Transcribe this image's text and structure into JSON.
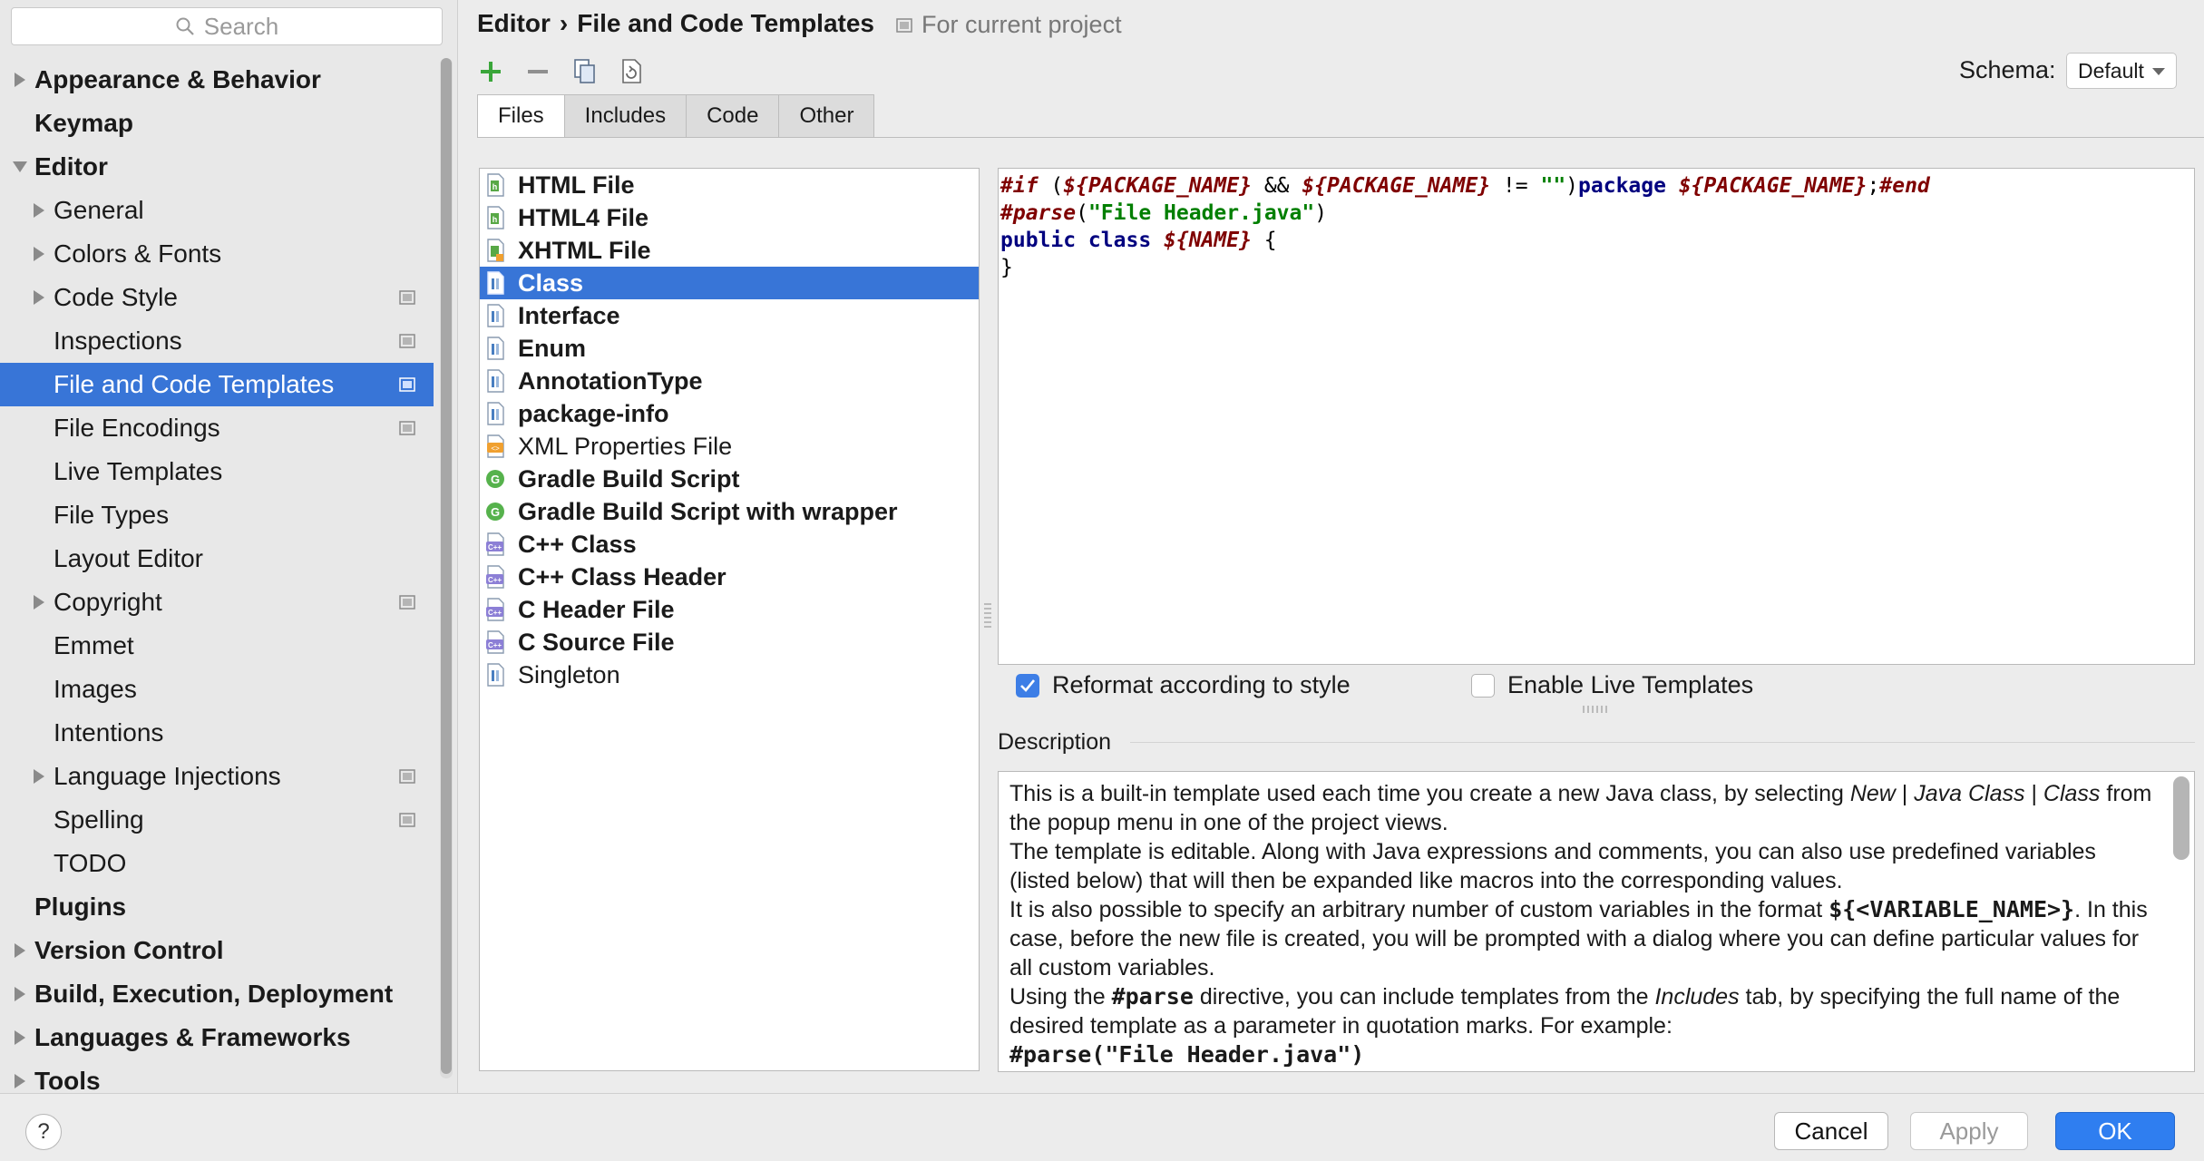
{
  "search": {
    "placeholder": "Search"
  },
  "sidebar": {
    "items": [
      {
        "label": "Appearance & Behavior",
        "level": 0,
        "bold": true,
        "arrow": "right",
        "project": false,
        "selected": false
      },
      {
        "label": "Keymap",
        "level": 0,
        "bold": true,
        "arrow": "none",
        "project": false,
        "selected": false
      },
      {
        "label": "Editor",
        "level": 0,
        "bold": true,
        "arrow": "down",
        "project": false,
        "selected": false
      },
      {
        "label": "General",
        "level": 1,
        "bold": false,
        "arrow": "right",
        "project": false,
        "selected": false
      },
      {
        "label": "Colors & Fonts",
        "level": 1,
        "bold": false,
        "arrow": "right",
        "project": false,
        "selected": false
      },
      {
        "label": "Code Style",
        "level": 1,
        "bold": false,
        "arrow": "right",
        "project": true,
        "selected": false
      },
      {
        "label": "Inspections",
        "level": 1,
        "bold": false,
        "arrow": "none",
        "project": true,
        "selected": false
      },
      {
        "label": "File and Code Templates",
        "level": 1,
        "bold": false,
        "arrow": "none",
        "project": true,
        "selected": true
      },
      {
        "label": "File Encodings",
        "level": 1,
        "bold": false,
        "arrow": "none",
        "project": true,
        "selected": false
      },
      {
        "label": "Live Templates",
        "level": 1,
        "bold": false,
        "arrow": "none",
        "project": false,
        "selected": false
      },
      {
        "label": "File Types",
        "level": 1,
        "bold": false,
        "arrow": "none",
        "project": false,
        "selected": false
      },
      {
        "label": "Layout Editor",
        "level": 1,
        "bold": false,
        "arrow": "none",
        "project": false,
        "selected": false
      },
      {
        "label": "Copyright",
        "level": 1,
        "bold": false,
        "arrow": "right",
        "project": true,
        "selected": false
      },
      {
        "label": "Emmet",
        "level": 1,
        "bold": false,
        "arrow": "none",
        "project": false,
        "selected": false
      },
      {
        "label": "Images",
        "level": 1,
        "bold": false,
        "arrow": "none",
        "project": false,
        "selected": false
      },
      {
        "label": "Intentions",
        "level": 1,
        "bold": false,
        "arrow": "none",
        "project": false,
        "selected": false
      },
      {
        "label": "Language Injections",
        "level": 1,
        "bold": false,
        "arrow": "right",
        "project": true,
        "selected": false
      },
      {
        "label": "Spelling",
        "level": 1,
        "bold": false,
        "arrow": "none",
        "project": true,
        "selected": false
      },
      {
        "label": "TODO",
        "level": 1,
        "bold": false,
        "arrow": "none",
        "project": false,
        "selected": false
      },
      {
        "label": "Plugins",
        "level": 0,
        "bold": true,
        "arrow": "none",
        "project": false,
        "selected": false
      },
      {
        "label": "Version Control",
        "level": 0,
        "bold": true,
        "arrow": "right",
        "project": false,
        "selected": false
      },
      {
        "label": "Build, Execution, Deployment",
        "level": 0,
        "bold": true,
        "arrow": "right",
        "project": false,
        "selected": false
      },
      {
        "label": "Languages & Frameworks",
        "level": 0,
        "bold": true,
        "arrow": "right",
        "project": false,
        "selected": false
      },
      {
        "label": "Tools",
        "level": 0,
        "bold": true,
        "arrow": "right",
        "project": false,
        "selected": false
      }
    ]
  },
  "header": {
    "crumb_parent": "Editor",
    "crumb_separator": "›",
    "crumb_current": "File and Code Templates",
    "scope": "For current project"
  },
  "toolbar": {
    "schema_label": "Schema:",
    "schema_value": "Default"
  },
  "tabs": [
    {
      "label": "Files",
      "active": true
    },
    {
      "label": "Includes",
      "active": false
    },
    {
      "label": "Code",
      "active": false
    },
    {
      "label": "Other",
      "active": false
    }
  ],
  "templates": [
    {
      "label": "HTML File",
      "icon": "html-file-icon",
      "bold": true,
      "selected": false
    },
    {
      "label": "HTML4 File",
      "icon": "html-file-icon",
      "bold": true,
      "selected": false
    },
    {
      "label": "XHTML File",
      "icon": "xhtml-file-icon",
      "bold": true,
      "selected": false
    },
    {
      "label": "Class",
      "icon": "java-file-icon",
      "bold": true,
      "selected": true
    },
    {
      "label": "Interface",
      "icon": "java-file-icon",
      "bold": true,
      "selected": false
    },
    {
      "label": "Enum",
      "icon": "java-file-icon",
      "bold": true,
      "selected": false
    },
    {
      "label": "AnnotationType",
      "icon": "java-file-icon",
      "bold": true,
      "selected": false
    },
    {
      "label": "package-info",
      "icon": "java-file-icon",
      "bold": true,
      "selected": false
    },
    {
      "label": "XML Properties File",
      "icon": "xml-file-icon",
      "bold": false,
      "selected": false
    },
    {
      "label": "Gradle Build Script",
      "icon": "gradle-icon",
      "bold": true,
      "selected": false
    },
    {
      "label": "Gradle Build Script with wrapper",
      "icon": "gradle-icon",
      "bold": true,
      "selected": false
    },
    {
      "label": "C++ Class",
      "icon": "cpp-file-icon",
      "bold": true,
      "selected": false
    },
    {
      "label": "C++ Class Header",
      "icon": "cpp-file-icon",
      "bold": true,
      "selected": false
    },
    {
      "label": "C Header File",
      "icon": "cpp-file-icon",
      "bold": true,
      "selected": false
    },
    {
      "label": "C Source File",
      "icon": "cpp-file-icon",
      "bold": true,
      "selected": false
    },
    {
      "label": "Singleton",
      "icon": "java-file-icon",
      "bold": false,
      "selected": false
    }
  ],
  "code": {
    "lines": [
      [
        {
          "t": "#if",
          "c": "kw-dir"
        },
        {
          "t": " (",
          "c": "plain"
        },
        {
          "t": "${PACKAGE_NAME}",
          "c": "var"
        },
        {
          "t": " && ",
          "c": "plain"
        },
        {
          "t": "${PACKAGE_NAME}",
          "c": "var"
        },
        {
          "t": " != ",
          "c": "plain"
        },
        {
          "t": "\"\"",
          "c": "str"
        },
        {
          "t": ")",
          "c": "plain"
        },
        {
          "t": "package ",
          "c": "kw"
        },
        {
          "t": "${PACKAGE_NAME}",
          "c": "var"
        },
        {
          "t": ";",
          "c": "plain"
        },
        {
          "t": "#end",
          "c": "kw-dir"
        }
      ],
      [
        {
          "t": "#parse",
          "c": "kw-dir"
        },
        {
          "t": "(",
          "c": "plain"
        },
        {
          "t": "\"File Header.java\"",
          "c": "str"
        },
        {
          "t": ")",
          "c": "plain"
        }
      ],
      [
        {
          "t": "public class ",
          "c": "kw"
        },
        {
          "t": "${NAME}",
          "c": "var"
        },
        {
          "t": " {",
          "c": "plain"
        }
      ],
      [
        {
          "t": "}",
          "c": "plain"
        }
      ]
    ]
  },
  "options": {
    "reformat_label": "Reformat according to style",
    "reformat_checked": true,
    "live_label": "Enable Live Templates",
    "live_checked": false
  },
  "description": {
    "label": "Description",
    "p1_a": "This is a built-in template used each time you create a new Java class, by selecting ",
    "p1_i1": "New",
    "p1_b": " | ",
    "p1_i2": "Java Class",
    "p1_c": " | ",
    "p1_i3": "Class",
    "p1_d": " from the popup menu in one of the project views.",
    "p2": "The template is editable. Along with Java expressions and comments, you can also use predefined variables (listed below) that will then be expanded like macros into the corresponding values.",
    "p3_a": "It is also possible to specify an arbitrary number of custom variables in the format ",
    "p3_code": "${<VARIABLE_NAME>}",
    "p3_b": ". In this case, before the new file is created, you will be prompted with a dialog where you can define particular values for all custom variables.",
    "p4_a": "Using the ",
    "p4_code": "#parse",
    "p4_b": " directive, you can include templates from the ",
    "p4_i": "Includes",
    "p4_c": " tab, by specifying the full name of the desired template as a parameter in quotation marks. For example:",
    "p5_code": "#parse(\"File Header.java\")"
  },
  "buttons": {
    "help": "?",
    "cancel": "Cancel",
    "apply": "Apply",
    "ok": "OK"
  }
}
